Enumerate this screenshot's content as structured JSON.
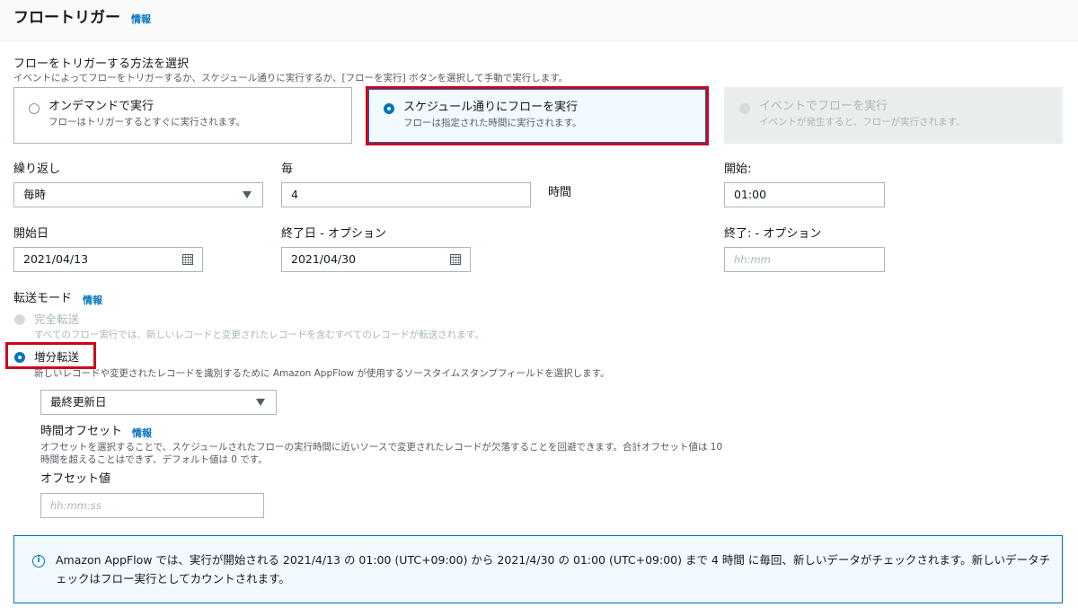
{
  "header": {
    "title": "フロートリガー",
    "info": "情報"
  },
  "trigger": {
    "heading": "フローをトリガーする方法を選択",
    "description": "イベントによってフローをトリガーするか、スケジュール通りに実行するか、[フローを実行] ボタンを選択して手動で実行します。",
    "options": [
      {
        "title": "オンデマンドで実行",
        "desc": "フローはトリガーするとすぐに実行されます。",
        "state": "unchecked"
      },
      {
        "title": "スケジュール通りにフローを実行",
        "desc": "フローは指定された時間に実行されます。",
        "state": "checked"
      },
      {
        "title": "イベントでフローを実行",
        "desc": "イベントが発生すると、フローが実行されます。",
        "state": "disabled"
      }
    ]
  },
  "schedule": {
    "repeat_label": "繰り返し",
    "repeat_value": "毎時",
    "every_label": "毎",
    "every_value": "4",
    "every_unit": "時間",
    "start_label": "開始:",
    "start_value": "01:00",
    "start_date_label": "開始日",
    "start_date_value": "2021/04/13",
    "end_date_label": "終了日 - オプション",
    "end_date_value": "2021/04/30",
    "end_time_label": "終了: - オプション",
    "end_time_placeholder": "hh:mm"
  },
  "transfer": {
    "label": "転送モード",
    "info": "情報",
    "full_title": "完全転送",
    "full_desc": "すべてのフロー実行では、新しいレコードと変更されたレコードを含むすべてのレコードが転送されます。",
    "incremental_title": "増分転送",
    "incremental_desc": "新しいレコードや変更されたレコードを識別するために Amazon AppFlow が使用するソースタイムスタンプフィールドを選択します。",
    "field_value": "最終更新日",
    "offset_label": "時間オフセット",
    "offset_info": "情報",
    "offset_desc_1": "オフセットを選択することで、スケジュールされたフローの実行時間に近いソースで変更されたレコードが欠落することを回避できます。合計オフセット値は 10",
    "offset_desc_2": "時間を超えることはできず、デフォルト値は 0 です。",
    "offset_value_label": "オフセット値",
    "offset_value_placeholder": "hh:mm:ss"
  },
  "alert": {
    "icon": "info-icon",
    "text": "Amazon AppFlow では、実行が開始される 2021/4/13 の 01:00 (UTC+09:00) から 2021/4/30 の 01:00 (UTC+09:00) まで 4 時間 に毎回、新しいデータがチェックされます。新しいデータチェックはフロー実行としてカウントされます。"
  },
  "colors": {
    "accent": "#0073bb",
    "highlight": "#d0021b",
    "text": "#16191f",
    "muted": "#545b64"
  }
}
